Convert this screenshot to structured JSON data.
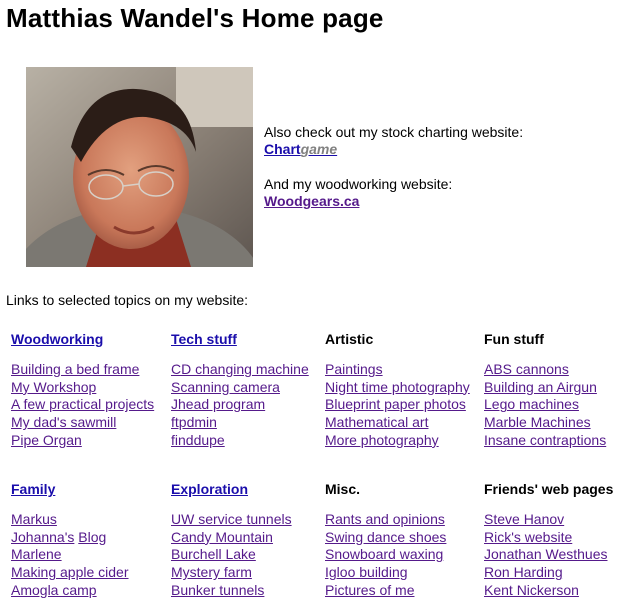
{
  "page": {
    "title": "Matthias Wandel's Home page",
    "also_text": "Also check out my stock charting website:",
    "chartgame": {
      "chart": "Chart",
      "game": "game"
    },
    "wood_text": "And my woodworking website:",
    "woodgears": "Woodgears.ca",
    "intro": "Links to selected topics on my website:"
  },
  "sections": [
    {
      "title": "Woodworking",
      "link": true,
      "items": [
        "Building a bed frame",
        "My Workshop",
        "A few practical projects",
        "My dad's sawmill",
        "Pipe Organ"
      ]
    },
    {
      "title": "Tech stuff",
      "link": true,
      "items": [
        "CD changing machine",
        "Scanning camera",
        "Jhead program",
        "ftpdmin",
        "finddupe"
      ]
    },
    {
      "title": "Artistic",
      "link": false,
      "items": [
        "Paintings",
        "Night time photography",
        "Blueprint paper photos",
        "Mathematical art",
        "More photography"
      ]
    },
    {
      "title": "Fun stuff",
      "link": false,
      "items": [
        "ABS cannons",
        "Building an Airgun",
        "Lego machines",
        "Marble Machines",
        "Insane contraptions"
      ]
    },
    {
      "title": "Family",
      "link": true,
      "items": [
        "Markus",
        "Johanna's",
        "Marlene",
        "Making apple cider",
        "Amogla camp"
      ],
      "blog": "Blog"
    },
    {
      "title": "Exploration",
      "link": true,
      "items": [
        "UW service tunnels",
        "Candy Mountain",
        "Burchell Lake",
        "Mystery farm",
        "Bunker tunnels"
      ]
    },
    {
      "title": "Misc.",
      "link": false,
      "items": [
        "Rants and opinions",
        "Swing dance shoes",
        "Snowboard waxing",
        "Igloo building",
        "Pictures of me"
      ]
    },
    {
      "title": "Friends' web pages",
      "link": false,
      "items": [
        "Steve Hanov",
        "Rick's website",
        "Jonathan Westhues",
        "Ron Harding",
        "Kent Nickerson"
      ]
    }
  ]
}
